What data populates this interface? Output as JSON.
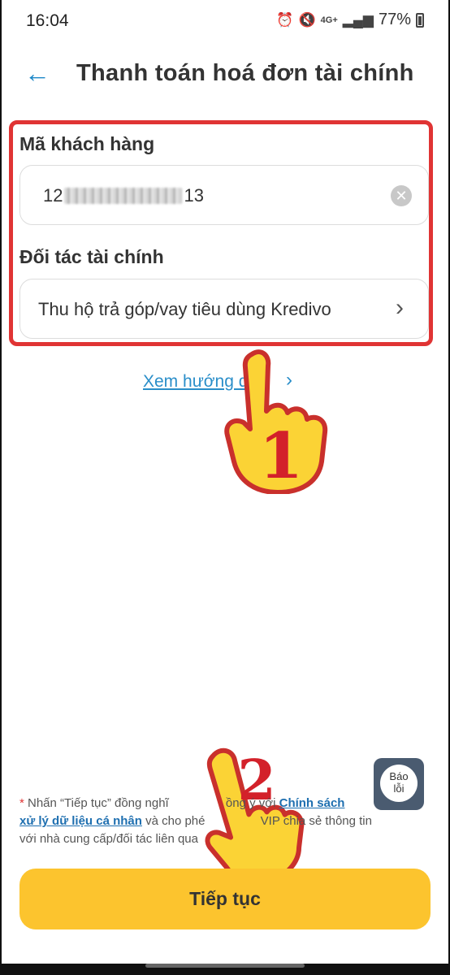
{
  "status_bar": {
    "time": "16:04",
    "network": "4G+",
    "battery": "77%",
    "icons": [
      "alarm-icon",
      "mute-icon",
      "signal-icon",
      "battery-icon"
    ]
  },
  "header": {
    "title": "Thanh toán hoá đơn tài chính",
    "back_icon": "arrow-left-icon"
  },
  "form": {
    "customer_code_label": "Mã khách hàng",
    "customer_code_prefix": "12",
    "customer_code_suffix": "13",
    "partner_label": "Đối tác tài chính",
    "partner_value": "Thu hộ trả góp/vay tiêu dùng Kredivo"
  },
  "guide": {
    "link_label": "Xem hướng d"
  },
  "annotations": {
    "step1": "1",
    "step2": "2",
    "highlight_color": "#e03434",
    "hand_color": "#fbd335"
  },
  "report_button": {
    "line1": "Báo",
    "line2": "lỗi"
  },
  "disclaimer": {
    "star": "*",
    "part1": " Nhấn “Tiếp tục” đồng nghĩ",
    "part2": "ồng ý với ",
    "link1": "Chính sách",
    "link2": "xử lý dữ liệu cá nhân",
    "part3": " và cho phé",
    "part4": " VIP chia sẻ thông tin",
    "part5": "với nhà cung cấp/đối tác liên qua"
  },
  "cta": {
    "label": "Tiếp tục",
    "color": "#fcc42e"
  },
  "colors": {
    "accent": "#1e88c8",
    "link": "#2a8ec9"
  }
}
